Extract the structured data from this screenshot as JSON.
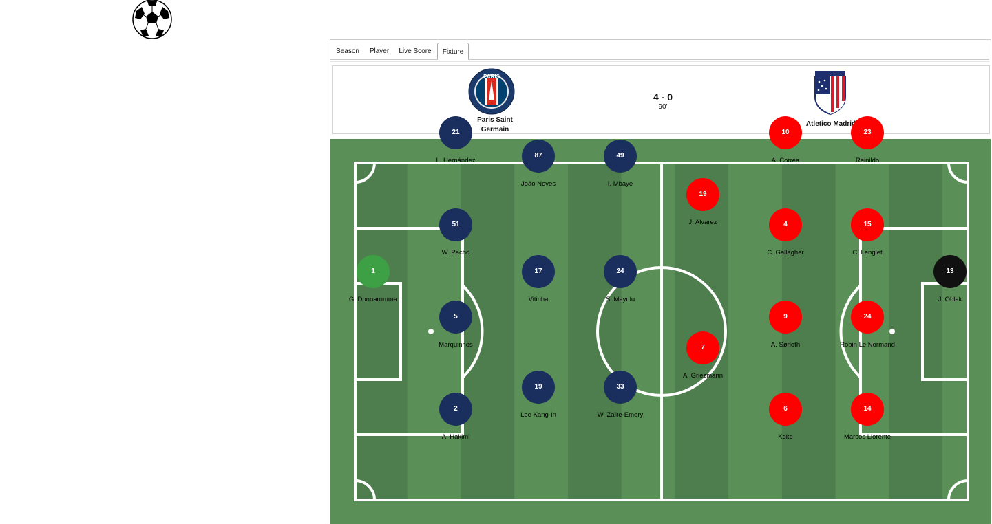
{
  "tabs": [
    "Season",
    "Player",
    "Live Score",
    "Fixture"
  ],
  "active_tab": "Fixture",
  "match": {
    "home": {
      "name": "Paris Saint Germain",
      "name_line1": "Paris Saint",
      "name_line2": "Germain",
      "logo_icon": "psg-crest-icon",
      "logo_text": "PARIS"
    },
    "away": {
      "name": "Atletico Madrid",
      "logo_icon": "atletico-crest-icon"
    },
    "score": "4 - 0",
    "minute": "90'"
  },
  "colors": {
    "pitch": "#5a8f57",
    "stripe_dark": "#4f7e4e",
    "stripe_light": "#5a8f57",
    "home_kit": "#1b2f5e",
    "home_gk": "#3ea044",
    "away_kit": "#ff0000",
    "away_gk": "#111111"
  },
  "home_players": [
    {
      "number": "1",
      "name": "G. Donnarumma",
      "gk": true
    },
    {
      "number": "21",
      "name": "L. Hernández"
    },
    {
      "number": "51",
      "name": "W. Pacho"
    },
    {
      "number": "5",
      "name": "Marquinhos"
    },
    {
      "number": "2",
      "name": "A. Hakimi"
    },
    {
      "number": "87",
      "name": "João Neves"
    },
    {
      "number": "17",
      "name": "Vitinha"
    },
    {
      "number": "19",
      "name": "Lee Kang-In"
    },
    {
      "number": "49",
      "name": "I. Mbaye"
    },
    {
      "number": "24",
      "name": "S. Mayulu"
    },
    {
      "number": "33",
      "name": "W. Zaïre-Emery"
    }
  ],
  "away_players": [
    {
      "number": "13",
      "name": "J. Oblak",
      "gk": true
    },
    {
      "number": "23",
      "name": "Reinildo"
    },
    {
      "number": "15",
      "name": "C. Lenglet"
    },
    {
      "number": "24",
      "name": "Robin Le Normand"
    },
    {
      "number": "14",
      "name": "Marcos Llorente"
    },
    {
      "number": "10",
      "name": "Á. Correa"
    },
    {
      "number": "4",
      "name": "C. Gallagher"
    },
    {
      "number": "9",
      "name": "A. Sørloth"
    },
    {
      "number": "6",
      "name": "Koke"
    },
    {
      "number": "19",
      "name": "J. Alvarez"
    },
    {
      "number": "7",
      "name": "A. Griezmann"
    }
  ]
}
